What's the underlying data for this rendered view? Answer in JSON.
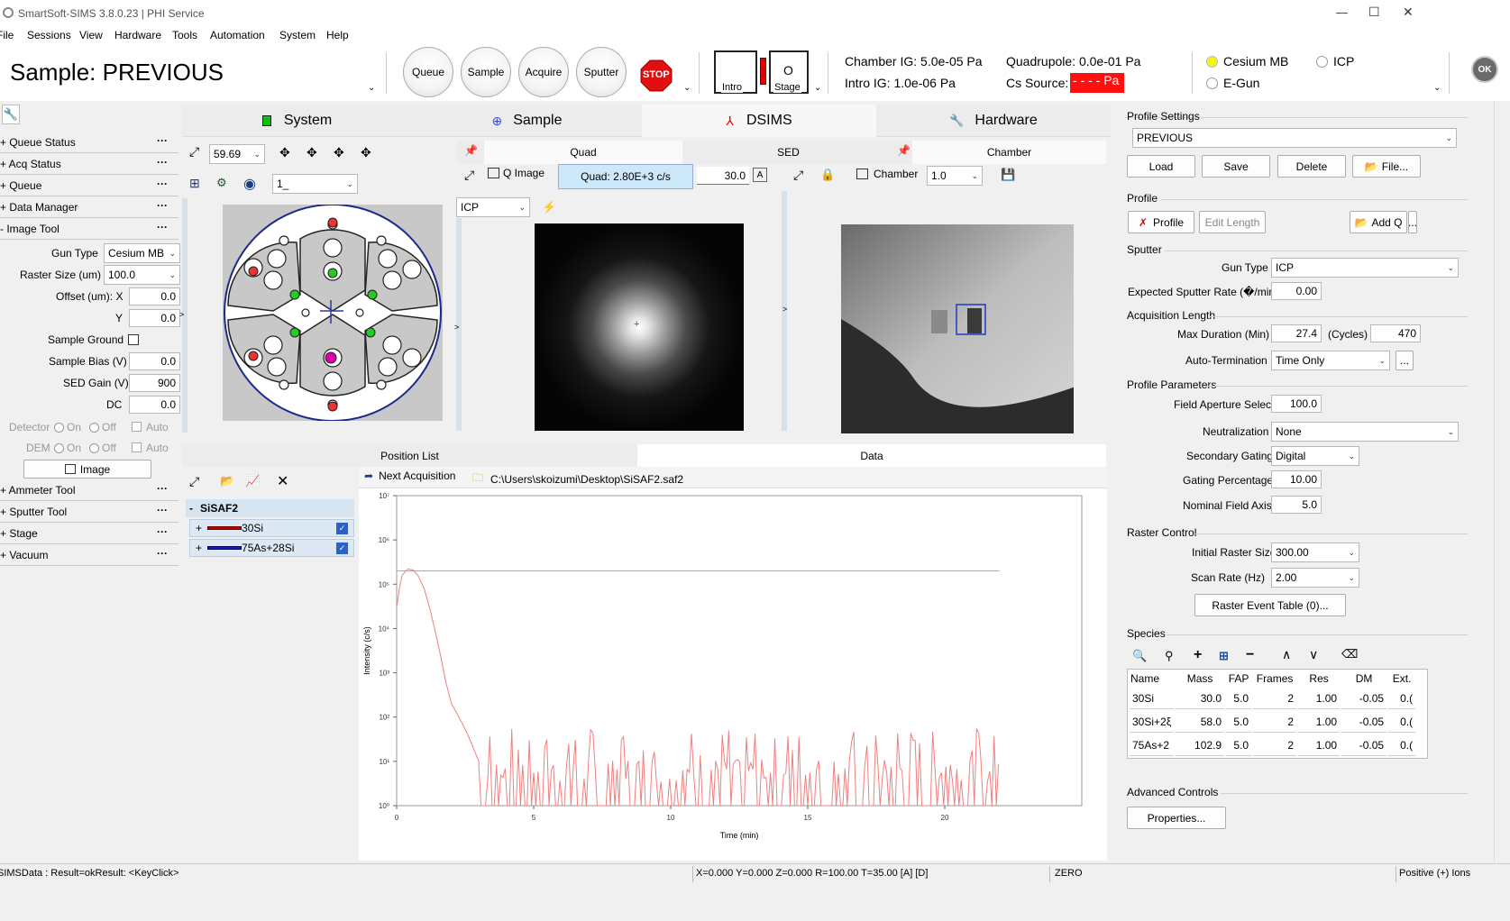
{
  "window": {
    "title": "SmartSoft-SIMS 3.8.0.23 | PHI Service",
    "min": "—",
    "max": "☐",
    "close": "✕"
  },
  "menu": [
    "File",
    "Sessions",
    "View",
    "Hardware",
    "Tools",
    "Automation",
    "System",
    "Help"
  ],
  "toolbar": {
    "sample_title": "Sample: PREVIOUS",
    "queue": "Queue",
    "sample": "Sample",
    "acquire": "Acquire",
    "sputter": "Sputter",
    "stop": "STOP",
    "intro": "Intro",
    "stage": "Stage",
    "stage_symbol": "O",
    "chamber_ig": "Chamber IG: 5.0e-05 Pa",
    "intro_ig": "Intro IG: 1.0e-06 Pa",
    "quadrupole": "Quadrupole: 0.0e-01 Pa",
    "cs_source_label": "Cs Source:",
    "cs_source_value": "- - - -  Pa",
    "source_cesium": "Cesium MB",
    "source_icp": "ICP",
    "source_egun": "E-Gun",
    "ok": "OK"
  },
  "sidebar": {
    "items_top": [
      "+ Queue Status",
      "+ Acq Status",
      "+ Queue",
      "+ Data Manager",
      "- Image Tool"
    ],
    "image_tool": {
      "gun_type_label": "Gun Type",
      "gun_type_value": "Cesium MB",
      "raster_label": "Raster Size (um)",
      "raster_value": "100.0",
      "offset_label": "Offset (um): X",
      "offset_x": "0.0",
      "y_label": "Y",
      "offset_y": "0.0",
      "sample_ground": "Sample Ground",
      "sample_bias_label": "Sample Bias (V)",
      "sample_bias": "0.0",
      "sed_gain_label": "SED Gain (V)",
      "sed_gain": "900",
      "dc_label": "DC",
      "dc": "0.0",
      "detector": "Detector",
      "dem": "DEM",
      "on": "On",
      "off": "Off",
      "auto": "Auto",
      "image_btn": "Image"
    },
    "items_bottom": [
      "+ Ammeter Tool",
      "+ Sputter Tool",
      "+ Stage",
      "+ Vacuum"
    ]
  },
  "main_tabs": [
    "System",
    "Sample",
    "DSIMS",
    "Hardware"
  ],
  "sample_panel": {
    "zoom": "59.69",
    "position": "1_"
  },
  "image_tabs": [
    "Quad",
    "SED",
    "Chamber"
  ],
  "quad": {
    "qimage": "Q Image",
    "rate": "Quad: 2.80E+3 c/s",
    "value": "30.0",
    "source": "ICP"
  },
  "chamber": {
    "label": "Chamber",
    "value": "1.0"
  },
  "lower_tabs": [
    "Position List",
    "Data"
  ],
  "data_tabs": {
    "next_acq": "Next Acquisition",
    "file": "C:\\Users\\skoizumi\\Desktop\\SiSAF2.saf2"
  },
  "tree": {
    "root": "SiSAF2",
    "items": [
      "30Si",
      "75As+28Si"
    ]
  },
  "chart_data": {
    "type": "line",
    "xlabel": "Time (min)",
    "ylabel": "Intensity (c/s)",
    "xlim": [
      0,
      25
    ],
    "xticks": [
      0,
      5,
      10,
      15,
      20
    ],
    "ylim": [
      1,
      10000000
    ],
    "yscale": "log",
    "yticks": [
      "10⁰",
      "10¹",
      "10²",
      "10³",
      "10⁴",
      "10⁵",
      "10⁶",
      "10⁷"
    ],
    "series": [
      {
        "name": "30Si",
        "color": "#f08080",
        "x": [
          0.0,
          0.1,
          0.2,
          0.4,
          0.6,
          0.8,
          1.0,
          1.2,
          1.4,
          1.6,
          1.8,
          2.0,
          2.2,
          2.4,
          2.6,
          2.8,
          3.0
        ],
        "values": [
          30000,
          80000,
          160000,
          220000,
          210000,
          150000,
          80000,
          30000,
          9000,
          2500,
          600,
          200,
          120,
          70,
          40,
          20,
          10
        ]
      },
      {
        "name": "75As+28Si",
        "color": "#7ec87e",
        "x": [
          0,
          22
        ],
        "values": [
          200000,
          200000
        ]
      }
    ]
  },
  "right": {
    "profile_settings": "Profile Settings",
    "profile_value": "PREVIOUS",
    "load": "Load",
    "save": "Save",
    "delete": "Delete",
    "file": "File...",
    "profile": "Profile",
    "profile_btn": "Profile",
    "edit_length": "Edit Length",
    "add_q": "Add Q",
    "more": "...",
    "sputter": "Sputter",
    "gun_type_label": "Gun Type",
    "gun_type_value": "ICP",
    "sputter_rate_label": "Expected Sputter Rate (�/min)",
    "sputter_rate": "0.00",
    "acq_length": "Acquisition Length",
    "max_dur_label": "Max Duration (Min)",
    "max_dur": "27.4",
    "cycles_label": "(Cycles)",
    "cycles": "470",
    "auto_term_label": "Auto-Termination",
    "auto_term": "Time Only",
    "profile_params": "Profile Parameters",
    "fas_label": "Field Aperture Select",
    "fas": "100.0",
    "neut_label": "Neutralization",
    "neut": "None",
    "sec_gating_label": "Secondary Gating",
    "sec_gating": "Digital",
    "gating_pct_label": "Gating Percentage",
    "gating_pct": "10.00",
    "nfa_label": "Nominal Field Axis",
    "nfa": "5.0",
    "raster_control": "Raster Control",
    "init_raster_label": "Initial Raster Size",
    "init_raster": "300.00",
    "scan_rate_label": "Scan Rate (Hz)",
    "scan_rate": "2.00",
    "raster_event": "Raster Event Table (0)...",
    "species": "Species",
    "species_cols": [
      "Name",
      "Mass",
      "FAP",
      "Frames",
      "Res",
      "DM",
      "Ext."
    ],
    "species_rows": [
      [
        "30Si",
        "30.0",
        "5.0",
        "2",
        "1.00",
        "-0.05",
        "0.("
      ],
      [
        "30Si+2ξ",
        "58.0",
        "5.0",
        "2",
        "1.00",
        "-0.05",
        "0.("
      ],
      [
        "75As+2",
        "102.9",
        "5.0",
        "2",
        "1.00",
        "-0.05",
        "0.("
      ]
    ],
    "advanced": "Advanced Controls",
    "properties": "Properties..."
  },
  "status": {
    "left": "SIMSData : Result=okResult: <KeyClick>",
    "coords": "X=0.000  Y=0.000  Z=0.000  R=100.00  T=35.00 [A] [D]",
    "zero": "ZERO",
    "mode": "Positive (+) Ions"
  }
}
